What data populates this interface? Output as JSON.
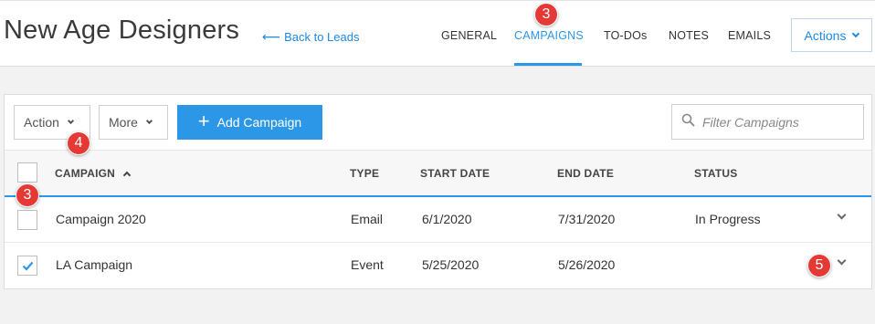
{
  "header": {
    "title": "New Age Designers",
    "back_link": "Back to Leads",
    "tabs": [
      {
        "label": "GENERAL",
        "active": false
      },
      {
        "label": "CAMPAIGNS",
        "active": true
      },
      {
        "label": "TO-DOs",
        "active": false
      },
      {
        "label": "NOTES",
        "active": false
      },
      {
        "label": "EMAILS",
        "active": false
      }
    ],
    "actions_label": "Actions"
  },
  "toolbar": {
    "action_label": "Action",
    "more_label": "More",
    "add_label": "Add Campaign",
    "filter_placeholder": "Filter Campaigns"
  },
  "table": {
    "columns": [
      "CAMPAIGN",
      "TYPE",
      "START DATE",
      "END DATE",
      "STATUS"
    ],
    "sort": {
      "column": "CAMPAIGN",
      "direction": "ascending"
    },
    "rows": [
      {
        "campaign": "Campaign 2020",
        "type": "Email",
        "start": "6/1/2020",
        "end": "7/31/2020",
        "status": "In Progress",
        "checked": false
      },
      {
        "campaign": "LA Campaign",
        "type": "Event",
        "start": "5/25/2020",
        "end": "5/26/2020",
        "status": "",
        "checked": true
      }
    ]
  },
  "callouts": [
    "3",
    "4",
    "3",
    "5"
  ],
  "colors": {
    "accent": "#2b97e6",
    "callout": "#e53935"
  },
  "icons": [
    "back-arrow-icon",
    "chevron-down-icon",
    "plus-icon",
    "search-icon",
    "sort-ascending-icon",
    "checkmark-icon"
  ]
}
